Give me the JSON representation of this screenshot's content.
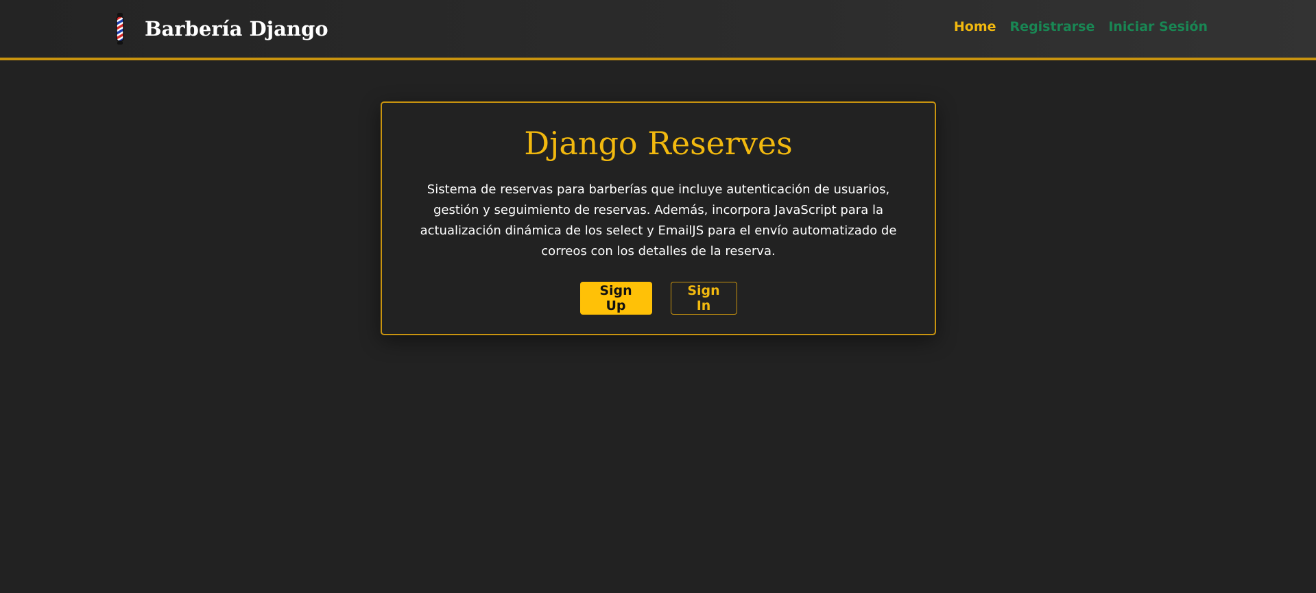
{
  "brand": {
    "icon": "barber-pole-icon",
    "name": "Barbería Django"
  },
  "nav": {
    "links": [
      {
        "label": "Home",
        "active": true
      },
      {
        "label": "Registrarse",
        "active": false
      },
      {
        "label": "Iniciar Sesión",
        "active": false
      }
    ]
  },
  "hero": {
    "title": "Django Reserves",
    "description": "Sistema de reservas para barberías que incluye autenticación de usuarios, gestión y seguimiento de reservas. Además, incorpora JavaScript para la actualización dinámica de los select y EmailJS para el envío automatizado de correos con los detalles de la reserva.",
    "signup_label": "Sign Up",
    "signin_label": "Sign In"
  },
  "colors": {
    "background": "#222222",
    "accent": "#ffc107",
    "accent_border": "#c9940f",
    "nav_link": "#198754",
    "nav_active": "#f2b90f"
  }
}
